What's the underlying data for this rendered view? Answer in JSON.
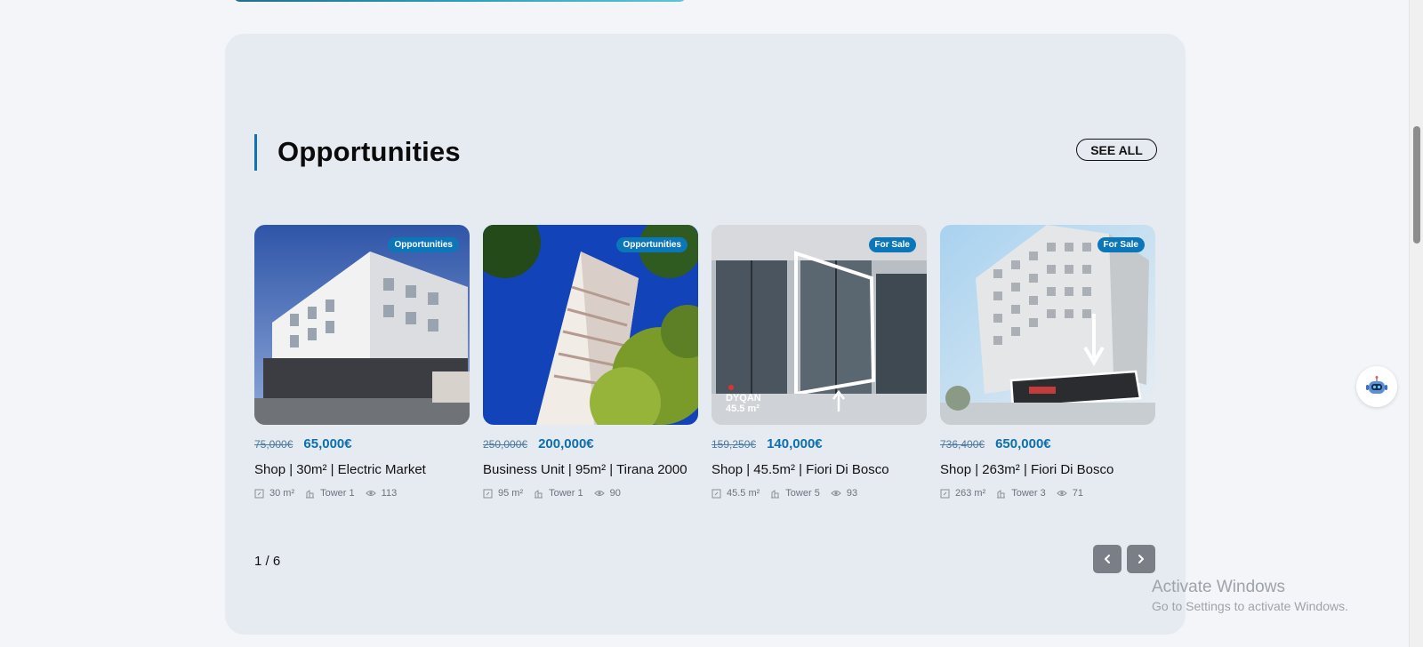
{
  "section": {
    "title": "Opportunities",
    "see_all_label": "SEE ALL"
  },
  "cards": [
    {
      "badge": "Opportunities",
      "old_price": "75,000€",
      "new_price": "65,000€",
      "title": "Shop | 30m² | Electric Market",
      "area": "30 m²",
      "tower": "Tower 1",
      "views": "113"
    },
    {
      "badge": "Opportunities",
      "old_price": "250,000€",
      "new_price": "200,000€",
      "title": "Business Unit | 95m² | Tirana 2000",
      "area": "95 m²",
      "tower": "Tower 1",
      "views": "90"
    },
    {
      "badge": "For Sale",
      "old_price": "159,250€",
      "new_price": "140,000€",
      "title": "Shop | 45.5m² | Fiori Di Bosco",
      "area": "45.5 m²",
      "tower": "Tower 5",
      "views": "93",
      "image_text_1": "DYQAN",
      "image_text_2": "45.5 m²"
    },
    {
      "badge": "For Sale",
      "old_price": "736,400€",
      "new_price": "650,000€",
      "title": "Shop | 263m² | Fiori Di Bosco",
      "area": "263 m²",
      "tower": "Tower 3",
      "views": "71"
    }
  ],
  "pager": {
    "text": "1 / 6"
  },
  "icons": {
    "prev": "chevron-left-icon",
    "next": "chevron-right-icon",
    "area": "area-icon",
    "tower": "building-icon",
    "views": "eye-icon",
    "assistant": "robot-icon"
  },
  "watermark": {
    "title": "Activate Windows",
    "subtitle": "Go to Settings to activate Windows."
  },
  "colors": {
    "accent": "#0c6fae",
    "badge": "#0c77b8",
    "panel": "#e6eaf1"
  }
}
